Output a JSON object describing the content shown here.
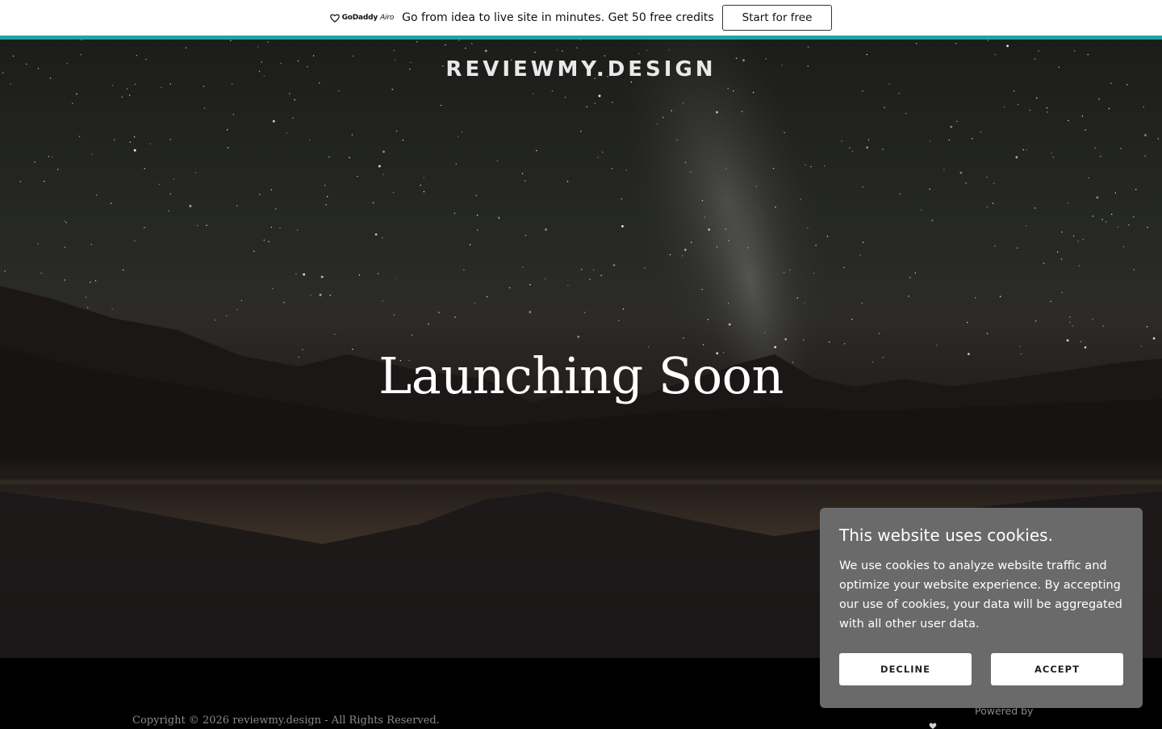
{
  "promo": {
    "brand_name": "GoDaddy",
    "brand_suffix": "Airo",
    "text": "Go from idea to live site in minutes. Get 50 free credits",
    "cta_label": "Start for free",
    "accent_color": "#1fa5a6"
  },
  "site": {
    "title": "REVIEWMY.DESIGN",
    "headline": "Launching Soon"
  },
  "cookie": {
    "title": "This website uses cookies.",
    "body": "We use cookies to analyze website traffic and optimize your website experience. By accepting our use of cookies, your data will be aggregated with all other user data.",
    "decline_label": "DECLINE",
    "accept_label": "ACCEPT"
  },
  "footer": {
    "copyright": "Copyright © 2026 reviewmy.design - All Rights Reserved.",
    "powered_by": "Powered by"
  }
}
